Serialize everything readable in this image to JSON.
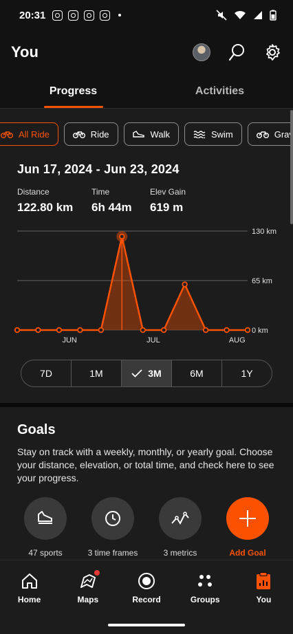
{
  "status": {
    "time": "20:31"
  },
  "header": {
    "title": "You"
  },
  "tabs": [
    {
      "label": "Progress"
    },
    {
      "label": "Activities"
    }
  ],
  "sports": [
    {
      "label": "All Ride",
      "icon": "bike-icon",
      "active": true
    },
    {
      "label": "Ride",
      "icon": "bike-icon"
    },
    {
      "label": "Walk",
      "icon": "shoe-icon"
    },
    {
      "label": "Swim",
      "icon": "wave-icon"
    },
    {
      "label": "Gravel",
      "icon": "gravel-bike-icon"
    }
  ],
  "summary": {
    "date_range": "Jun 17, 2024 - Jun 23, 2024",
    "distance_label": "Distance",
    "distance_value": "122.80 km",
    "time_label": "Time",
    "time_value": "6h 44m",
    "elev_label": "Elev Gain",
    "elev_value": "619 m"
  },
  "chart_data": {
    "type": "line",
    "y_unit": "km",
    "ylim": [
      0,
      130
    ],
    "y_ticks": [
      "130 km",
      "65 km",
      "0 km"
    ],
    "x_tick_labels": [
      "JUN",
      "JUL",
      "AUG"
    ],
    "values": [
      0,
      0,
      0,
      0,
      0,
      122.8,
      0,
      0,
      60,
      0,
      0,
      0
    ],
    "highlight_index": 5,
    "accent": "#fc5200"
  },
  "ranges": [
    {
      "label": "7D"
    },
    {
      "label": "1M"
    },
    {
      "label": "3M",
      "active": true
    },
    {
      "label": "6M"
    },
    {
      "label": "1Y"
    }
  ],
  "goals": {
    "title": "Goals",
    "description": "Stay on track with a weekly, monthly, or yearly goal. Choose your distance, elevation, or total time, and check here to see your progress.",
    "options": [
      {
        "label": "47 sports",
        "icon": "shoe-icon"
      },
      {
        "label": "3 time frames",
        "icon": "clock-icon"
      },
      {
        "label": "3 metrics",
        "icon": "metrics-icon"
      },
      {
        "label": "Add Goal",
        "icon": "plus-icon"
      }
    ]
  },
  "nav": [
    {
      "label": "Home"
    },
    {
      "label": "Maps"
    },
    {
      "label": "Record"
    },
    {
      "label": "Groups"
    },
    {
      "label": "You"
    }
  ],
  "colors": {
    "accent": "#fc5200",
    "background": "#121212",
    "card": "#1c1c1c"
  }
}
